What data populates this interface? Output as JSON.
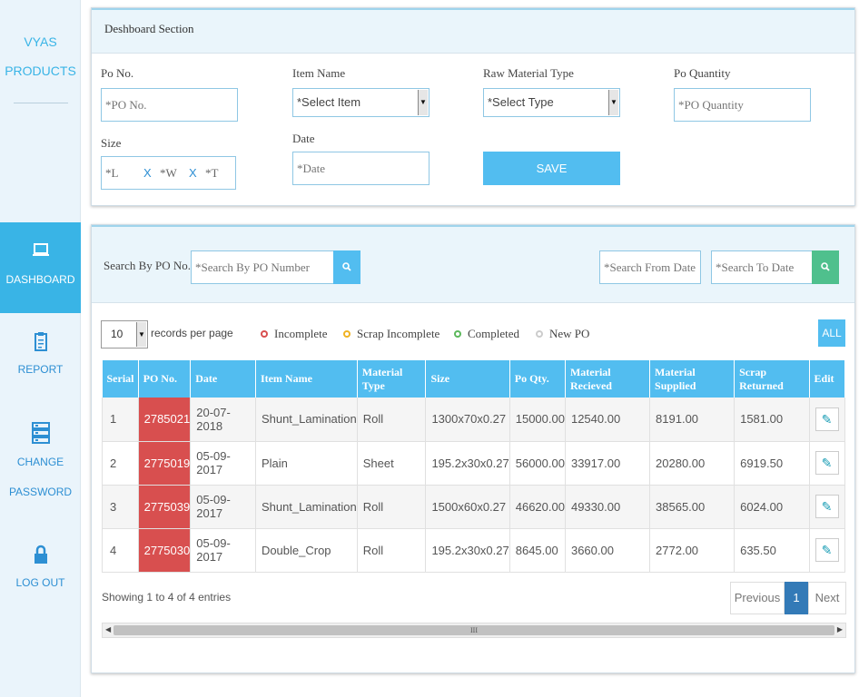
{
  "brand": {
    "line1": "VYAS",
    "line2": "PRODUCTS"
  },
  "nav": [
    {
      "label": "DASHBOARD",
      "icon": "monitor-icon",
      "active": true
    },
    {
      "label": "REPORT",
      "icon": "clipboard-icon"
    },
    {
      "label_line1": "CHANGE",
      "label_line2": "PASSWORD",
      "icon": "server-icon"
    },
    {
      "label": "LOG OUT",
      "icon": "lock-icon"
    }
  ],
  "form": {
    "title": "Deshboard Section",
    "po_no": {
      "label": "Po No.",
      "placeholder": "*PO No."
    },
    "item_name": {
      "label": "Item Name",
      "value": "*Select Item"
    },
    "raw_material": {
      "label": "Raw Material Type",
      "value": "*Select Type"
    },
    "po_quantity": {
      "label": "Po Quantity",
      "placeholder": "*PO Quantity"
    },
    "size": {
      "label": "Size",
      "l": "*L",
      "w": "*W",
      "t": "*T",
      "sep": "X"
    },
    "date": {
      "label": "Date",
      "placeholder": "*Date"
    },
    "save_label": "SAVE"
  },
  "list": {
    "search_label": "Search By PO No.",
    "search_placeholder": "*Search By PO Number",
    "from_placeholder": "*Search From Date",
    "to_placeholder": "*Search To Date",
    "records_per_page": "10",
    "records_label": "records per page",
    "legend": [
      {
        "label": "Incomplete",
        "color": "#d84f4f"
      },
      {
        "label": "Scrap Incomplete",
        "color": "#f0b323"
      },
      {
        "label": "Completed",
        "color": "#5cb85c"
      },
      {
        "label": "New PO",
        "color": "#cccccc"
      }
    ],
    "all_label": "ALL",
    "columns": [
      "Serial",
      "PO No.",
      "Date",
      "Item Name",
      "Material Type",
      "Size",
      "Po Qty.",
      "Material Recieved",
      "Material Supplied",
      "Scrap Returned",
      "Edit"
    ],
    "rows": [
      [
        "1",
        "2785021",
        "20-07-2018",
        "Shunt_Lamination",
        "Roll",
        "1300x70x0.27",
        "15000.00",
        "12540.00",
        "8191.00",
        "1581.00"
      ],
      [
        "2",
        "2775019",
        "05-09-2017",
        "Plain",
        "Sheet",
        "195.2x30x0.27",
        "56000.00",
        "33917.00",
        "20280.00",
        "6919.50"
      ],
      [
        "3",
        "2775039",
        "05-09-2017",
        "Shunt_Lamination",
        "Roll",
        "1500x60x0.27",
        "46620.00",
        "49330.00",
        "38565.00",
        "6024.00"
      ],
      [
        "4",
        "2775030",
        "05-09-2017",
        "Double_Crop",
        "Roll",
        "195.2x30x0.27",
        "8645.00",
        "3660.00",
        "2772.00",
        "635.50"
      ]
    ],
    "showing": "Showing 1 to 4 of 4 entries",
    "pager": {
      "previous": "Previous",
      "current": "1",
      "next": "Next"
    },
    "scroll_grip": "III"
  }
}
